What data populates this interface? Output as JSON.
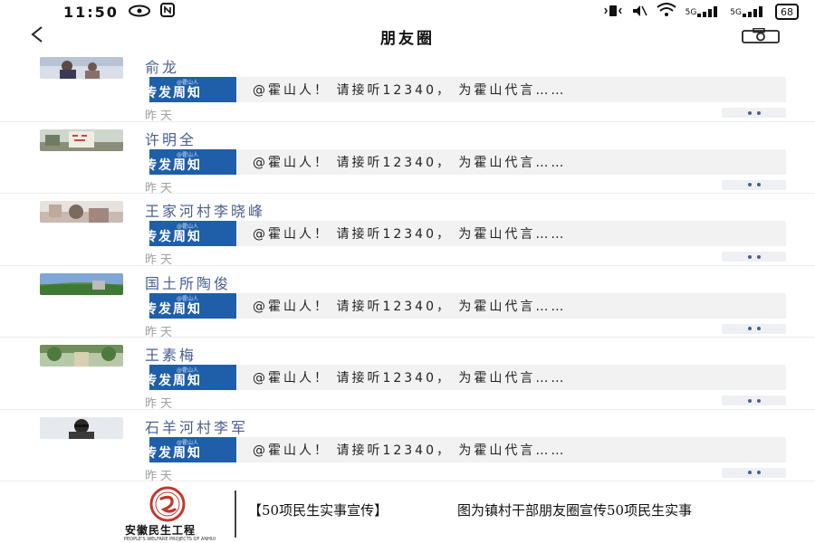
{
  "status_bar": {
    "time": "11:50",
    "network": "5G",
    "network2": "5G",
    "battery": "68"
  },
  "nav": {
    "title": "朋友圈"
  },
  "feed": [
    {
      "name": "俞龙",
      "card_thumb_title": "传发周知",
      "card_thumb_small": "@霍山人",
      "card_text": "@霍山人！ 请接听12340， 为霍山代言……",
      "time": "昨天"
    },
    {
      "name": "许明全",
      "card_thumb_title": "传发周知",
      "card_thumb_small": "@霍山人",
      "card_text": "@霍山人！ 请接听12340， 为霍山代言……",
      "time": "昨天"
    },
    {
      "name": "王家河村李晓峰",
      "card_thumb_title": "传发周知",
      "card_thumb_small": "@霍山人",
      "card_text": "@霍山人！ 请接听12340， 为霍山代言……",
      "time": "昨天"
    },
    {
      "name": "国土所陶俊",
      "card_thumb_title": "传发周知",
      "card_thumb_small": "@霍山人",
      "card_text": "@霍山人！ 请接听12340， 为霍山代言……",
      "time": "昨天"
    },
    {
      "name": "王素梅",
      "card_thumb_title": "传发周知",
      "card_thumb_small": "@霍山人",
      "card_text": "@霍山人！ 请接听12340， 为霍山代言……",
      "time": "昨天"
    },
    {
      "name": "石羊河村李军",
      "card_thumb_title": "传发周知",
      "card_thumb_small": "@霍山人",
      "card_text": "@霍山人！ 请接听12340， 为霍山代言……",
      "time": "昨天"
    }
  ],
  "caption": {
    "logo_title": "安徽民生工程",
    "logo_subtitle": "PEOPLE'S WELFARE PROJECTS OF ANHUI",
    "tag": "【50项民生实事宣传】",
    "text": "图为镇村干部朋友圈宣传50项民生实事"
  },
  "icons": {
    "back": "back-arrow-icon",
    "camera": "camera-icon",
    "more": "more-dots-icon"
  },
  "colors": {
    "name_link": "#4a5f8f",
    "card_thumb": "#1f5ea8",
    "card_bg": "#f2f2f2",
    "time_gray": "#a0a0a0",
    "logo_red": "#c0392b"
  }
}
